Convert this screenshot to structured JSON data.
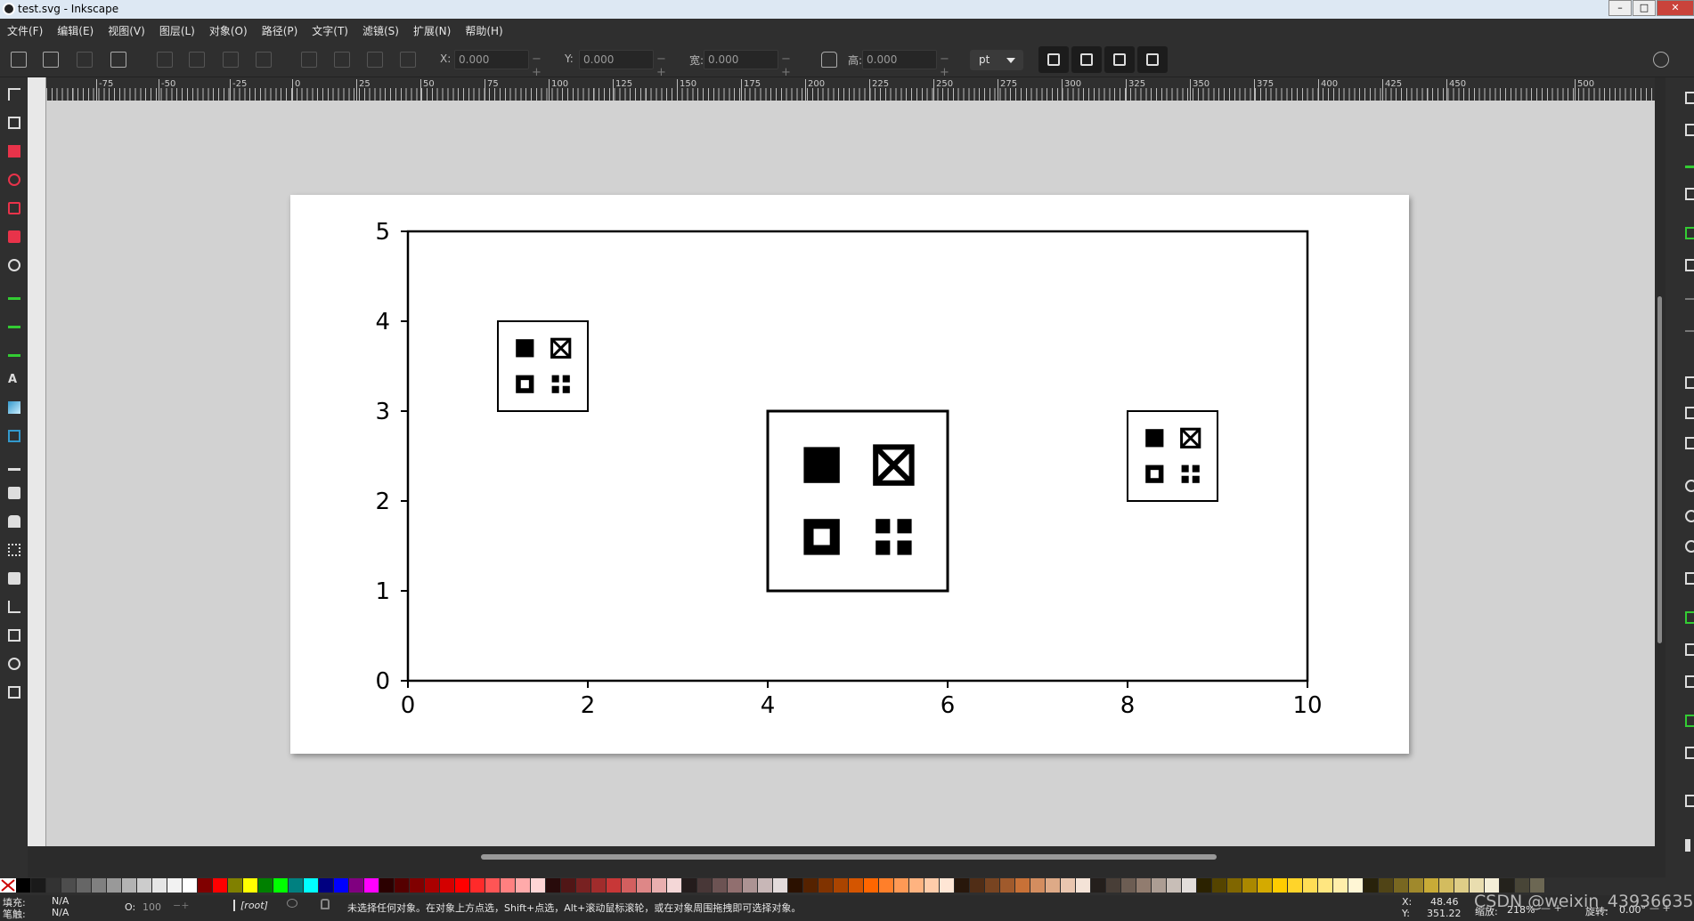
{
  "window": {
    "title": "test.svg - Inkscape",
    "controls": [
      "–",
      "□",
      "✕"
    ]
  },
  "menu": [
    "文件(F)",
    "编辑(E)",
    "视图(V)",
    "图层(L)",
    "对象(O)",
    "路径(P)",
    "文字(T)",
    "滤镜(S)",
    "扩展(N)",
    "帮助(H)"
  ],
  "toolbar": {
    "x": {
      "label": "X:",
      "value": "0.000"
    },
    "y": {
      "label": "Y:",
      "value": "0.000"
    },
    "w": {
      "label": "宽:",
      "value": "0.000"
    },
    "h": {
      "label": "高:",
      "value": "0.000"
    },
    "unit": "pt"
  },
  "ruler": {
    "labels": [
      "-75",
      "-50",
      "-25",
      "0",
      "25",
      "50",
      "75",
      "100",
      "125",
      "150",
      "175",
      "200",
      "225",
      "250",
      "275",
      "300",
      "325",
      "350",
      "375",
      "400",
      "425",
      "450",
      "500"
    ]
  },
  "chart_data": {
    "type": "scatter",
    "x_ticks": [
      "0",
      "2",
      "4",
      "6",
      "8",
      "10"
    ],
    "y_ticks": [
      "0",
      "1",
      "2",
      "3",
      "4",
      "5"
    ],
    "xlim": [
      0,
      10
    ],
    "ylim": [
      0,
      5
    ],
    "grid": false,
    "markers": [
      {
        "name": "",
        "x": [
          1,
          2
        ],
        "y": [
          3,
          4
        ],
        "note": ""
      },
      {
        "name": "",
        "x": [
          4,
          6
        ],
        "y": [
          1,
          3
        ],
        "note": ""
      },
      {
        "name": "",
        "x": [
          8,
          9
        ],
        "y": [
          2,
          3
        ],
        "note": ""
      }
    ]
  },
  "palette": [
    "#000000",
    "#1a1a1a",
    "#333333",
    "#4d4d4d",
    "#666666",
    "#808080",
    "#999999",
    "#b3b3b3",
    "#cccccc",
    "#e6e6e6",
    "#f2f2f2",
    "#ffffff",
    "#800000",
    "#ff0000",
    "#808000",
    "#ffff00",
    "#008000",
    "#00ff00",
    "#008080",
    "#00ffff",
    "#000080",
    "#0000ff",
    "#800080",
    "#ff00ff",
    "#2b0000",
    "#550000",
    "#800000",
    "#aa0000",
    "#d40000",
    "#ff0000",
    "#ff2a2a",
    "#ff5555",
    "#ff8080",
    "#ffaaaa",
    "#ffd5d5",
    "#280b0b",
    "#501616",
    "#782121",
    "#a02c2c",
    "#c83737",
    "#d35f5f",
    "#de8787",
    "#e9afaf",
    "#f4d7d7",
    "#241c1c",
    "#483737",
    "#6c5353",
    "#916f6f",
    "#ac9393",
    "#c8b7b7",
    "#e3dbdb",
    "#2b1100",
    "#552200",
    "#803300",
    "#aa4400",
    "#d45500",
    "#ff6600",
    "#ff7f2a",
    "#ff9955",
    "#ffb380",
    "#ffccaa",
    "#ffe6d5",
    "#28170b",
    "#502d16",
    "#784421",
    "#a05a2c",
    "#c87137",
    "#d38d5f",
    "#deaa87",
    "#e9c6af",
    "#f4e3d7",
    "#241f1c",
    "#483e37",
    "#6c5d53",
    "#917c6f",
    "#ac9d93",
    "#c8beb7",
    "#e3dedb",
    "#2b2200",
    "#554400",
    "#806600",
    "#aa8800",
    "#d4aa00",
    "#ffcc00",
    "#ffd42a",
    "#ffdd55",
    "#ffe680",
    "#ffeeaa",
    "#fff6d5",
    "#28220b",
    "#504416",
    "#786721",
    "#a0892c",
    "#c8ab37",
    "#d3bc5f",
    "#decd87",
    "#e9ddaf",
    "#f4eed7",
    "#24221c",
    "#484537",
    "#6c6753"
  ],
  "status": {
    "fill_label": "填充:",
    "fill_value": "N/A",
    "stroke_label": "笔触:",
    "stroke_value": "N/A",
    "opacity_label": "O:",
    "opacity_value": "100",
    "layer": "[root]",
    "message": "未选择任何对象。在对象上方点选，Shift+点选，Alt+滚动鼠标滚轮，或在对象周围拖拽即可选择对象。",
    "x_label": "X:",
    "x_value": "48.46",
    "y_label": "Y:",
    "y_value": "351.22",
    "zoom_label": "缩放:",
    "zoom_value": "218%",
    "rotate_label": "旋转:",
    "rotate_value": "0.00°",
    "watermark": "CSDN @weixin_43936635"
  }
}
